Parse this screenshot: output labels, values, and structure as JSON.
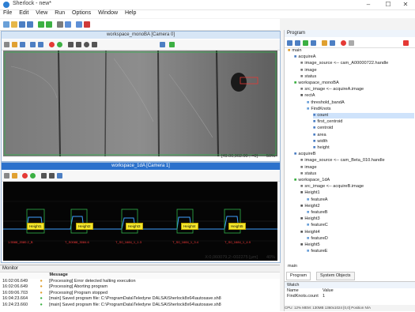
{
  "window": {
    "title": "Sherlock - new*",
    "minimize": "–",
    "maximize": "☐",
    "close": "✕"
  },
  "menu": [
    "File",
    "Edit",
    "View",
    "Run",
    "Options",
    "Window",
    "Help"
  ],
  "toolbar_icons": [
    "new-file-icon",
    "open-folder-icon",
    "save-icon",
    "save-as-icon",
    "run-icon",
    "run-continuous-icon",
    "step-icon",
    "grid-icon",
    "pause-icon",
    "stop-icon"
  ],
  "pane1": {
    "title": "workspace_monoBA [Camera 0]",
    "status_coords": "[49.00,902.00 ; =0]",
    "status_zoom": "50%",
    "tools": [
      "pointer-tool-icon",
      "hand-tool-icon",
      "camera-icon",
      "zoom-out-icon",
      "zoom-in-icon",
      "record-icon",
      "live-icon",
      "line-tool-icon",
      "rect-tool-icon",
      "ellipse-tool-icon",
      "poly-tool-icon",
      "gear-icon",
      "settings-icon"
    ]
  },
  "pane2": {
    "title": "workspace_1dA [Camera 1]",
    "status_coords": "X:0,060079,2:-002275 [µm]",
    "status_zoom": "40%",
    "labels": [
      "Height1",
      "Height2",
      "Height3",
      "Height4",
      "Height5"
    ],
    "red_labels": [
      "1.5588_2080.2_B",
      "T_S0088_3084.6",
      "T_S0_1684_1_1.3",
      "T_S0_1684_1_3.4",
      "T_S0_1684_1_4.9"
    ]
  },
  "monitor": {
    "title": "Monitor",
    "col_message": "Message",
    "rows": [
      {
        "time": "16:02:06.649",
        "msg": "[Processing] Error detected halting execution"
      },
      {
        "time": "16:02:06.649",
        "msg": "[Processing] Aborting program"
      },
      {
        "time": "16:09:06.703",
        "msg": "[Processing] Program stopped"
      },
      {
        "time": "16:04:23.664",
        "msg": "[main] Saved program file: C:\\ProgramData\\Teledyne DALSA\\Sherlock8x64\\autosave.sh8"
      },
      {
        "time": "16:24:23.660",
        "msg": "[main] Saved program file: C:\\ProgramData\\Teledyne DALSA\\Sherlock8x64\\autosave.sh8"
      }
    ]
  },
  "program": {
    "title": "Program",
    "tree": [
      {
        "label": "main",
        "indent": 0,
        "kind": "folder"
      },
      {
        "label": "acquireA",
        "indent": 1,
        "kind": "acq"
      },
      {
        "label": "image_source <-- cam_A00000722.handle",
        "indent": 2,
        "kind": "param"
      },
      {
        "label": "image",
        "indent": 2,
        "kind": "param"
      },
      {
        "label": "status",
        "indent": 2,
        "kind": "param"
      },
      {
        "label": "workspace_monoBA",
        "indent": 1,
        "kind": "ws"
      },
      {
        "label": "src_image <-- acquireA.image",
        "indent": 2,
        "kind": "param"
      },
      {
        "label": "rectA",
        "indent": 2,
        "kind": "roi"
      },
      {
        "label": "threshold_bandA",
        "indent": 3,
        "kind": "alg"
      },
      {
        "label": "FindKnots",
        "indent": 3,
        "kind": "alg"
      },
      {
        "label": "count",
        "indent": 4,
        "kind": "out",
        "selected": true
      },
      {
        "label": "first_centroid",
        "indent": 4,
        "kind": "out"
      },
      {
        "label": "centroid",
        "indent": 4,
        "kind": "out"
      },
      {
        "label": "area",
        "indent": 4,
        "kind": "out"
      },
      {
        "label": "width",
        "indent": 4,
        "kind": "out"
      },
      {
        "label": "height",
        "indent": 4,
        "kind": "out"
      },
      {
        "label": "acquireB",
        "indent": 1,
        "kind": "acq"
      },
      {
        "label": "image_source <-- cam_Beta_010.handle",
        "indent": 2,
        "kind": "param"
      },
      {
        "label": "image",
        "indent": 2,
        "kind": "param"
      },
      {
        "label": "status",
        "indent": 2,
        "kind": "param"
      },
      {
        "label": "workspace_1dA",
        "indent": 1,
        "kind": "ws"
      },
      {
        "label": "src_image <-- acquireB.image",
        "indent": 2,
        "kind": "param"
      },
      {
        "label": "Height1",
        "indent": 2,
        "kind": "roi"
      },
      {
        "label": "featureA",
        "indent": 3,
        "kind": "alg"
      },
      {
        "label": "Height2",
        "indent": 2,
        "kind": "roi"
      },
      {
        "label": "featureB",
        "indent": 3,
        "kind": "alg"
      },
      {
        "label": "Height3",
        "indent": 2,
        "kind": "roi"
      },
      {
        "label": "featureC",
        "indent": 3,
        "kind": "alg"
      },
      {
        "label": "Height4",
        "indent": 2,
        "kind": "roi"
      },
      {
        "label": "featureD",
        "indent": 3,
        "kind": "alg"
      },
      {
        "label": "Height5",
        "indent": 2,
        "kind": "roi"
      },
      {
        "label": "featureE",
        "indent": 3,
        "kind": "alg"
      }
    ],
    "bottom_label": "main",
    "tabs": [
      "Program",
      "System Objects"
    ]
  },
  "watch": {
    "title": "Watch",
    "col_name": "Name",
    "col_value": "Value",
    "rows": [
      {
        "name": "FindKnots.count",
        "value": "1"
      }
    ]
  },
  "statusbar": "CPU: 12%   MEM: 130MB   1360x1024   [0,0]   Position   N/A"
}
